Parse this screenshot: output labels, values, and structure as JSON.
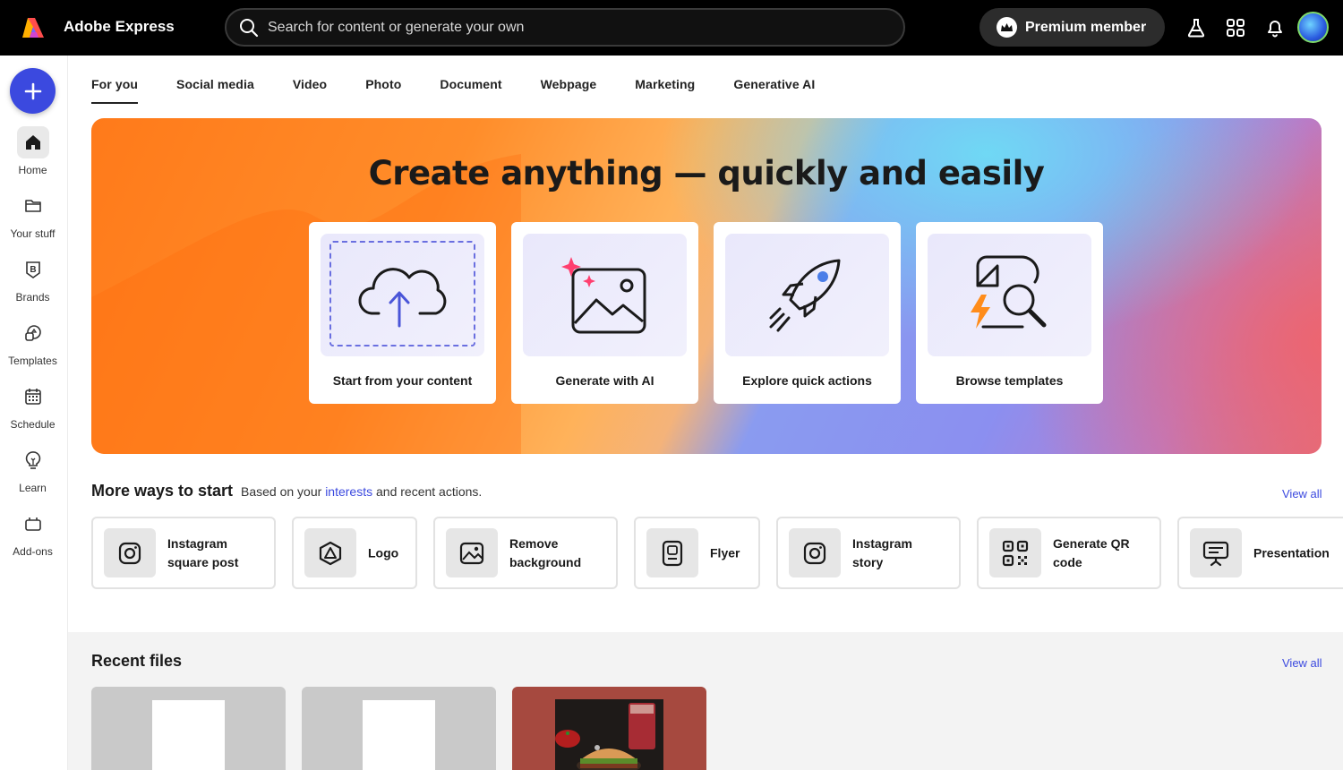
{
  "app": {
    "title": "Adobe Express"
  },
  "search": {
    "placeholder": "Search for content or generate your own"
  },
  "header": {
    "premium_label": "Premium member",
    "icons": [
      "flask-icon",
      "apps-grid-icon",
      "bell-icon",
      "avatar"
    ]
  },
  "rail": {
    "create_icon": "plus-icon",
    "items": [
      {
        "label": "Home",
        "icon": "home-icon"
      },
      {
        "label": "Your stuff",
        "icon": "folder-icon"
      },
      {
        "label": "Brands",
        "icon": "brand-icon"
      },
      {
        "label": "Templates",
        "icon": "templates-icon"
      },
      {
        "label": "Schedule",
        "icon": "calendar-icon"
      },
      {
        "label": "Learn",
        "icon": "lightbulb-icon"
      },
      {
        "label": "Add-ons",
        "icon": "addons-icon"
      }
    ]
  },
  "tabs": [
    "For you",
    "Social media",
    "Video",
    "Photo",
    "Document",
    "Webpage",
    "Marketing",
    "Generative AI"
  ],
  "hero": {
    "title": "Create anything — quickly and easily",
    "cards": [
      {
        "label": "Start from your content",
        "icon": "cloud-upload-icon"
      },
      {
        "label": "Generate with AI",
        "icon": "image-sparkle-icon"
      },
      {
        "label": "Explore quick actions",
        "icon": "rocket-icon"
      },
      {
        "label": "Browse templates",
        "icon": "template-search-icon"
      }
    ]
  },
  "more_ways": {
    "title": "More ways to start",
    "subtitle_pre": "Based on your",
    "subtitle_link": "interests",
    "subtitle_post": "and recent actions.",
    "view_all": "View all",
    "items": [
      {
        "line1": "Instagram",
        "line2": "square post",
        "icon": "instagram-icon"
      },
      {
        "line1": "Logo",
        "line2": "",
        "icon": "logo-icon"
      },
      {
        "line1": "Remove",
        "line2": "background",
        "icon": "remove-bg-icon"
      },
      {
        "line1": "Flyer",
        "line2": "",
        "icon": "flyer-icon"
      },
      {
        "line1": "Instagram",
        "line2": "story",
        "icon": "instagram-icon"
      },
      {
        "line1": "Generate QR",
        "line2": "code",
        "icon": "qr-code-icon"
      },
      {
        "line1": "Presentation",
        "line2": "",
        "icon": "presentation-icon"
      }
    ]
  },
  "recent_files": {
    "title": "Recent files",
    "view_all": "View all"
  }
}
